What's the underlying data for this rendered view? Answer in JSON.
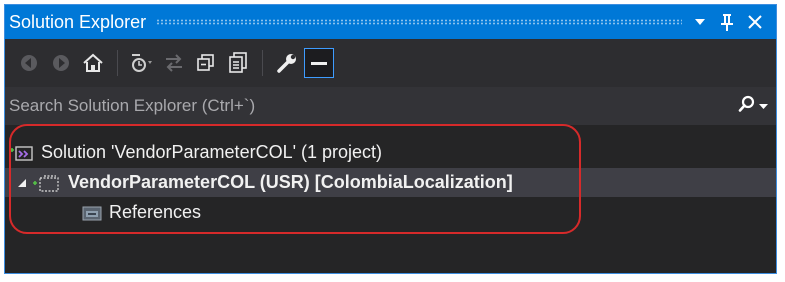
{
  "window": {
    "title": "Solution Explorer",
    "controls": {
      "dropdown_icon": "dropdown-arrow-icon",
      "pin_icon": "pin-icon",
      "close_icon": "close-icon"
    }
  },
  "toolbar": {
    "buttons": [
      {
        "icon": "back-icon"
      },
      {
        "icon": "forward-icon"
      },
      {
        "icon": "home-icon"
      },
      {
        "icon": "pending-changes-filter-icon"
      },
      {
        "icon": "sync-with-active-document-icon"
      },
      {
        "icon": "collapse-all-icon"
      },
      {
        "icon": "show-all-files-icon"
      },
      {
        "icon": "properties-wrench-icon"
      },
      {
        "icon": "preview-selected-items-icon"
      }
    ]
  },
  "search": {
    "placeholder": "Search Solution Explorer (Ctrl+`)",
    "icon": "search-icon"
  },
  "tree": {
    "solution": {
      "label": "Solution 'VendorParameterCOL' (1 project)",
      "icon": "solution-icon"
    },
    "project": {
      "label": "VendorParameterCOL (USR) [ColombiaLocalization]",
      "icon": "project-icon",
      "expanded": true
    },
    "references": {
      "label": "References",
      "icon": "references-icon"
    }
  },
  "colors": {
    "titlebar": "#0078d7",
    "panel_bg": "#252526",
    "selected_row": "#3f3f46",
    "callout": "#d62a2a"
  }
}
